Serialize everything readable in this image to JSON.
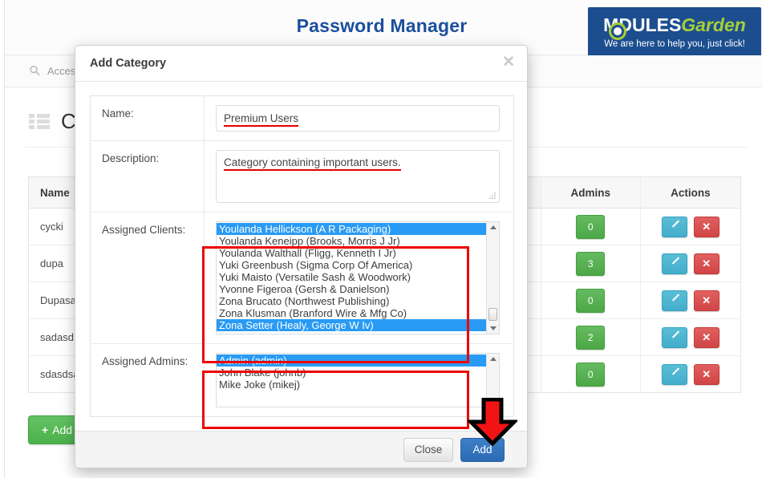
{
  "header": {
    "title": "Password Manager",
    "brand": {
      "name_part1": "M",
      "name_part2": "DULES",
      "name_part3": "Garden",
      "tagline": "We are here to help you, just click!",
      "bg_color": "#1c4e8f",
      "accent_color": "#a6ce39"
    },
    "title_color": "#1b4f9c"
  },
  "searchbar": {
    "icon": "search-icon",
    "label": "Acces"
  },
  "section": {
    "icon": "list-icon",
    "title": "C"
  },
  "table": {
    "columns": [
      "Name",
      "",
      "Admins",
      "Actions"
    ],
    "rows": [
      {
        "name": "cycki",
        "admins": "0",
        "edit": "",
        "delete": "✕"
      },
      {
        "name": "dupa",
        "admins": "3",
        "edit": "",
        "delete": "✕"
      },
      {
        "name": "Dupasas",
        "admins": "0",
        "edit": "",
        "delete": "✕"
      },
      {
        "name": "sadasd",
        "admins": "2",
        "edit": "",
        "delete": "✕"
      },
      {
        "name": "sdasdsa",
        "admins": "0",
        "edit": "",
        "delete": "✕"
      }
    ],
    "add_button": {
      "plus": "+",
      "label": "Add"
    }
  },
  "modal": {
    "title": "Add Category",
    "close_icon": "✕",
    "fields": {
      "name_label": "Name:",
      "name_value": "Premium Users",
      "description_label": "Description:",
      "description_value": "Category containing important users.",
      "assigned_clients_label": "Assigned Clients:",
      "assigned_admins_label": "Assigned Admins:"
    },
    "assigned_clients": [
      {
        "label": "Youlanda Hellickson (A R Packaging)",
        "selected": true
      },
      {
        "label": "Youlanda Keneipp (Brooks, Morris J Jr)",
        "selected": false
      },
      {
        "label": "Youlanda Walthall (Fligg, Kenneth I Jr)",
        "selected": false
      },
      {
        "label": "Yuki Greenbush (Sigma Corp Of America)",
        "selected": false
      },
      {
        "label": "Yuki Maisto (Versatile Sash & Woodwork)",
        "selected": false
      },
      {
        "label": "Yvonne Figeroa (Gersh & Danielson)",
        "selected": false
      },
      {
        "label": "Zona Brucato (Northwest Publishing)",
        "selected": false
      },
      {
        "label": "Zona Klusman (Branford Wire & Mfg Co)",
        "selected": false
      },
      {
        "label": "Zona Setter (Healy, George W Iv)",
        "selected": true
      }
    ],
    "assigned_admins": [
      {
        "label": "Admin (admin)",
        "selected": true
      },
      {
        "label": "John Blake (johnb)",
        "selected": false
      },
      {
        "label": "Mike Joke (mikej)",
        "selected": false
      }
    ],
    "footer": {
      "close_label": "Close",
      "submit_label": "Add"
    }
  },
  "annotations": {
    "highlight_color": "#ee0000",
    "arrow": "down-arrow-annotation",
    "selection_color": "#2a9bf4"
  }
}
